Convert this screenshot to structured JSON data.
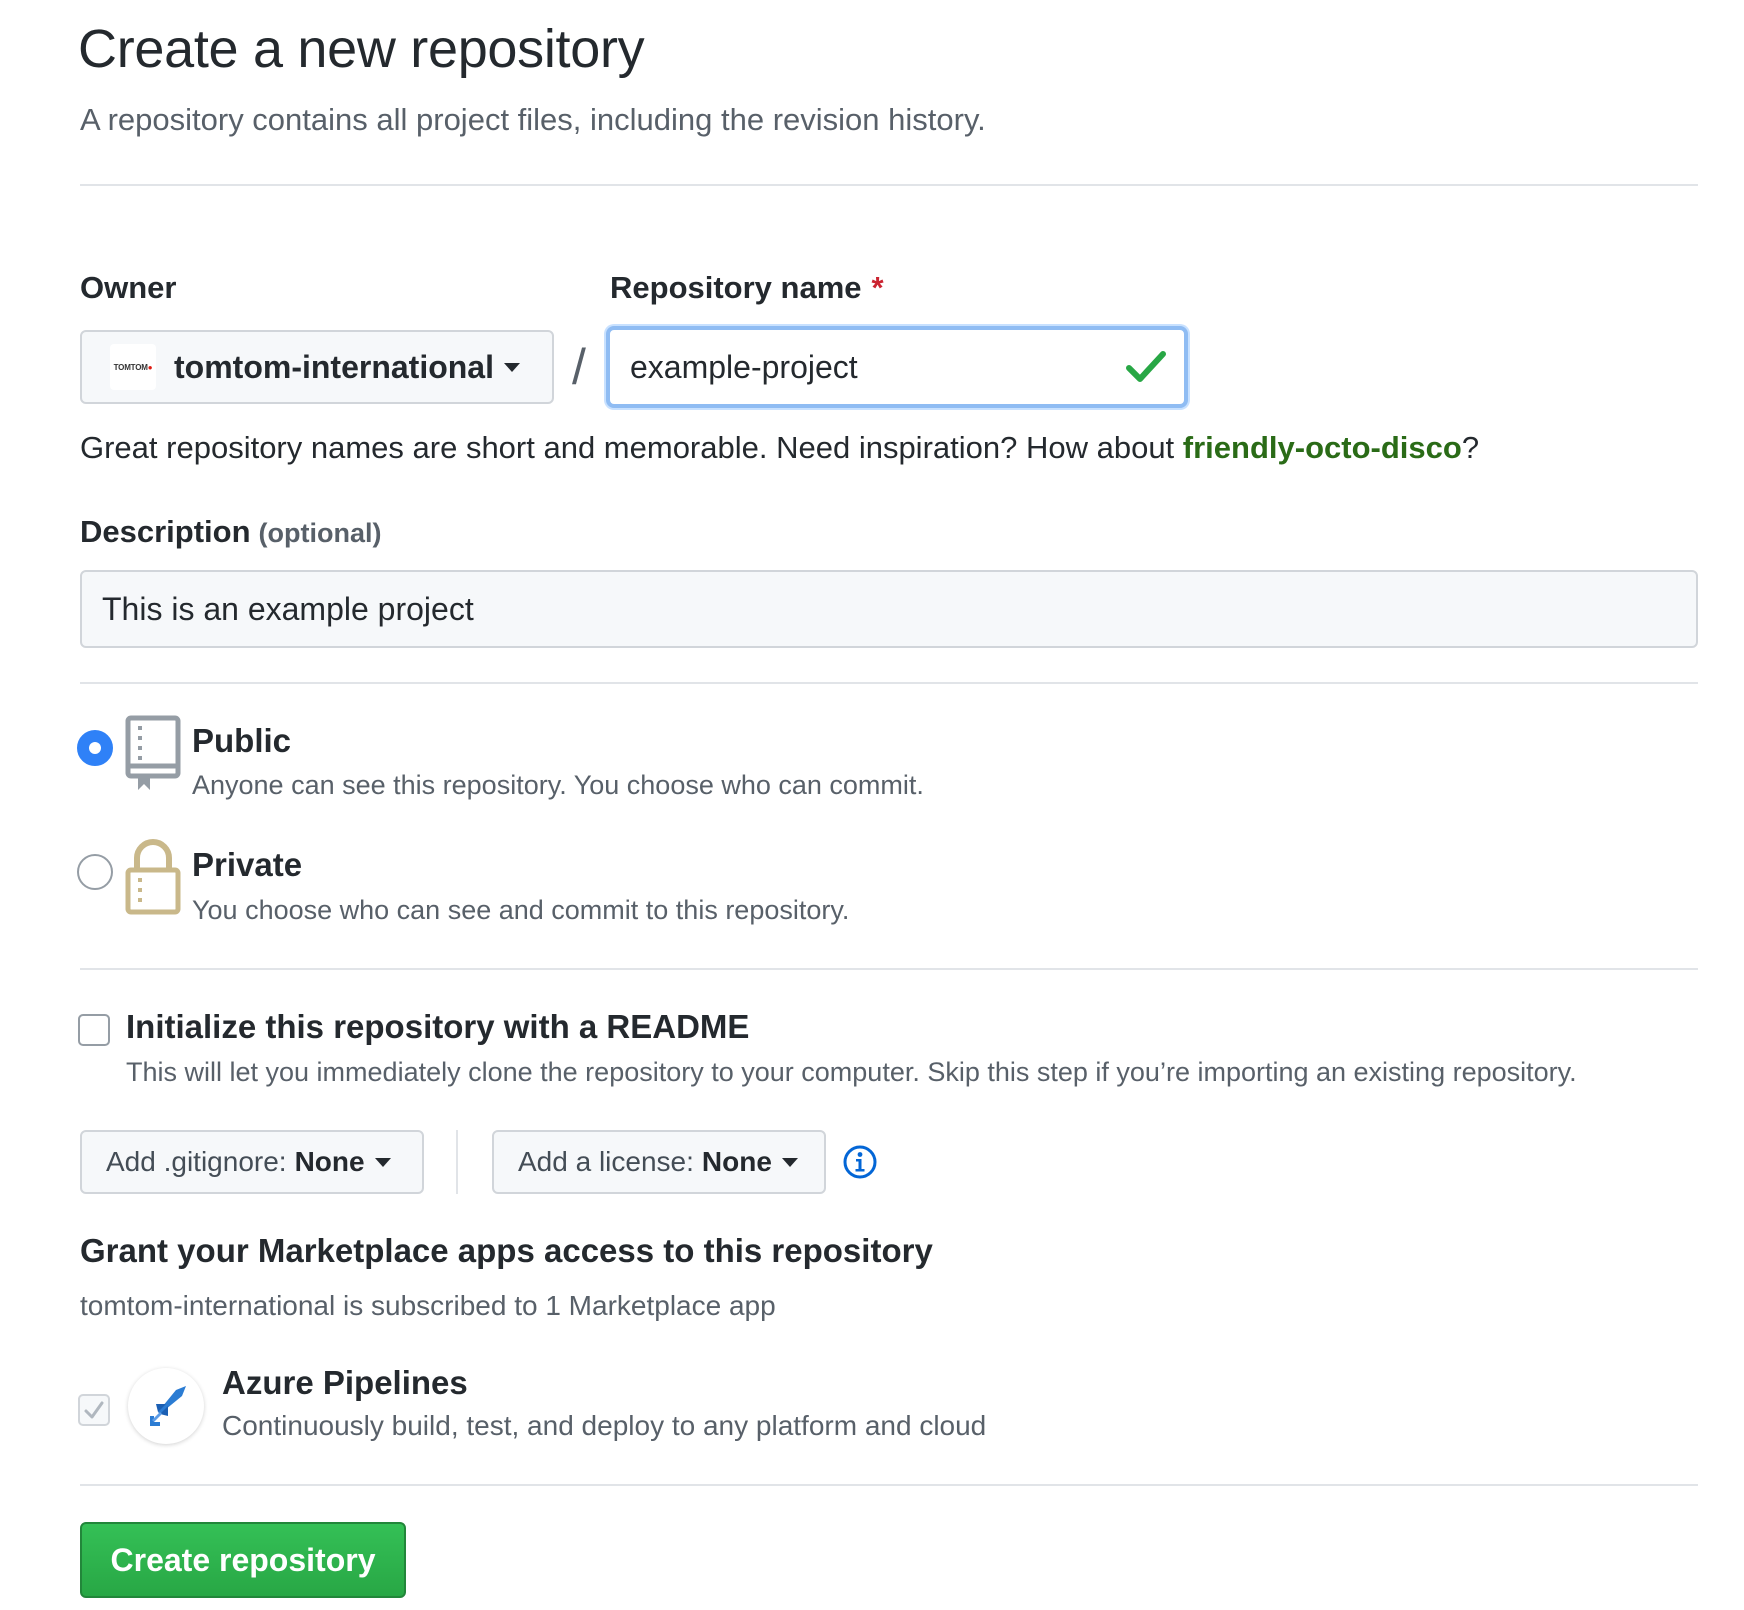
{
  "header": {
    "title": "Create a new repository",
    "subtitle": "A repository contains all project files, including the revision history."
  },
  "owner": {
    "label": "Owner",
    "logo_text": "TOMTOM",
    "logo_accent": "●",
    "value": "tomtom-international",
    "icon": "caret-down-icon"
  },
  "separator": "/",
  "repo_name": {
    "label": "Repository name",
    "required_mark": "*",
    "value": "example-project",
    "valid_icon": "check-icon"
  },
  "name_hint": {
    "text_before": "Great repository names are short and memorable. Need inspiration? How about ",
    "suggestion": "friendly-octo-disco",
    "text_after": "?"
  },
  "description": {
    "label": "Description",
    "optional_note": "(optional)",
    "value": "This is an example project"
  },
  "visibility": {
    "selected": "public",
    "options": [
      {
        "id": "public",
        "title": "Public",
        "description": "Anyone can see this repository. You choose who can commit.",
        "icon": "repo-icon"
      },
      {
        "id": "private",
        "title": "Private",
        "description": "You choose who can see and commit to this repository.",
        "icon": "lock-icon"
      }
    ]
  },
  "readme": {
    "checked": false,
    "title": "Initialize this repository with a README",
    "description": "This will let you immediately clone the repository to your computer. Skip this step if you’re importing an existing repository."
  },
  "gitignore": {
    "label": "Add .gitignore:",
    "value": "None"
  },
  "license": {
    "label": "Add a license:",
    "value": "None",
    "info_icon": "info-icon"
  },
  "marketplace": {
    "heading": "Grant your Marketplace apps access to this repository",
    "subheading": "tomtom-international is subscribed to 1 Marketplace app",
    "apps": [
      {
        "name": "Azure Pipelines",
        "description": "Continuously build, test, and deploy to any platform and cloud",
        "checked": true,
        "disabled": true,
        "icon": "azure-pipelines-icon"
      }
    ]
  },
  "submit": {
    "label": "Create repository"
  },
  "colors": {
    "primary_button": "#2ea44f",
    "radio_selected": "#2f81f7",
    "suggestion_link": "#2a6b17",
    "required": "#cb2431",
    "valid_check": "#28a745"
  }
}
